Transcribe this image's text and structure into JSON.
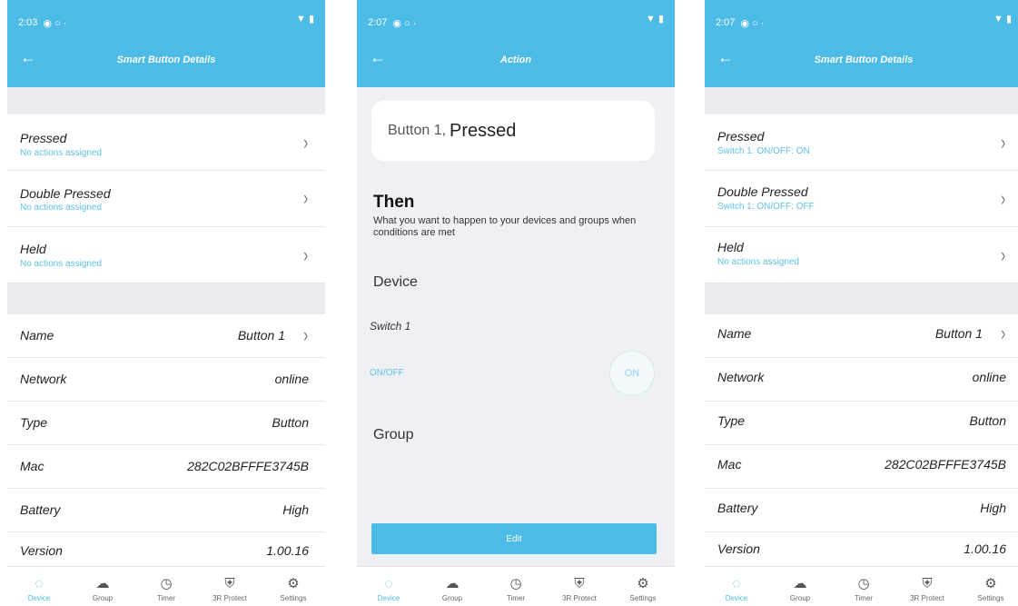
{
  "status_bar": {
    "screen1_time": "2:03",
    "screen2_time": "2:07",
    "screen3_time": "2:07",
    "icons": "◉ ○ ·",
    "right_icons": "▼ ▮"
  },
  "details": {
    "title": "Smart Button Details",
    "back_icon": "←",
    "chevron": "›"
  },
  "screen1": {
    "actions": [
      {
        "label": "Pressed",
        "sub": "No actions assigned"
      },
      {
        "label": "Double Pressed",
        "sub": "No actions assigned"
      },
      {
        "label": "Held",
        "sub": "No actions assigned"
      }
    ]
  },
  "screen3": {
    "actions": [
      {
        "label": "Pressed",
        "sub": "Switch 1: ON/OFF: ON"
      },
      {
        "label": "Double Pressed",
        "sub": "Switch 1: ON/OFF: OFF"
      },
      {
        "label": "Held",
        "sub": "No actions assigned"
      }
    ]
  },
  "info": [
    {
      "label": "Name",
      "value": "Button 1"
    },
    {
      "label": "Network",
      "value": "online"
    },
    {
      "label": "Type",
      "value": "Button"
    },
    {
      "label": "Mac",
      "value": "282C02BFFFE3745B"
    },
    {
      "label": "Battery",
      "value": "High"
    },
    {
      "label": "Version",
      "value": "1.00.16"
    }
  ],
  "action_screen": {
    "title": "Action",
    "trigger_prefix": "Button 1,",
    "trigger_event": "Pressed",
    "then_title": "Then",
    "then_sub": "What you want to happen to your devices and groups when conditions are met",
    "device_label": "Device",
    "device_name": "Switch 1",
    "attribute": "ON/OFF",
    "state": "ON",
    "group_label": "Group",
    "edit_button": "Edit"
  },
  "tabs": [
    {
      "label": "Device",
      "icon": "◌",
      "active": true
    },
    {
      "label": "Group",
      "icon": "☁",
      "active": false
    },
    {
      "label": "Timer",
      "icon": "◷",
      "active": false
    },
    {
      "label": "3R Protect",
      "icon": "⛨",
      "active": false
    },
    {
      "label": "Settings",
      "icon": "⚙",
      "active": false
    }
  ],
  "accent_color": "#4cbbe6"
}
